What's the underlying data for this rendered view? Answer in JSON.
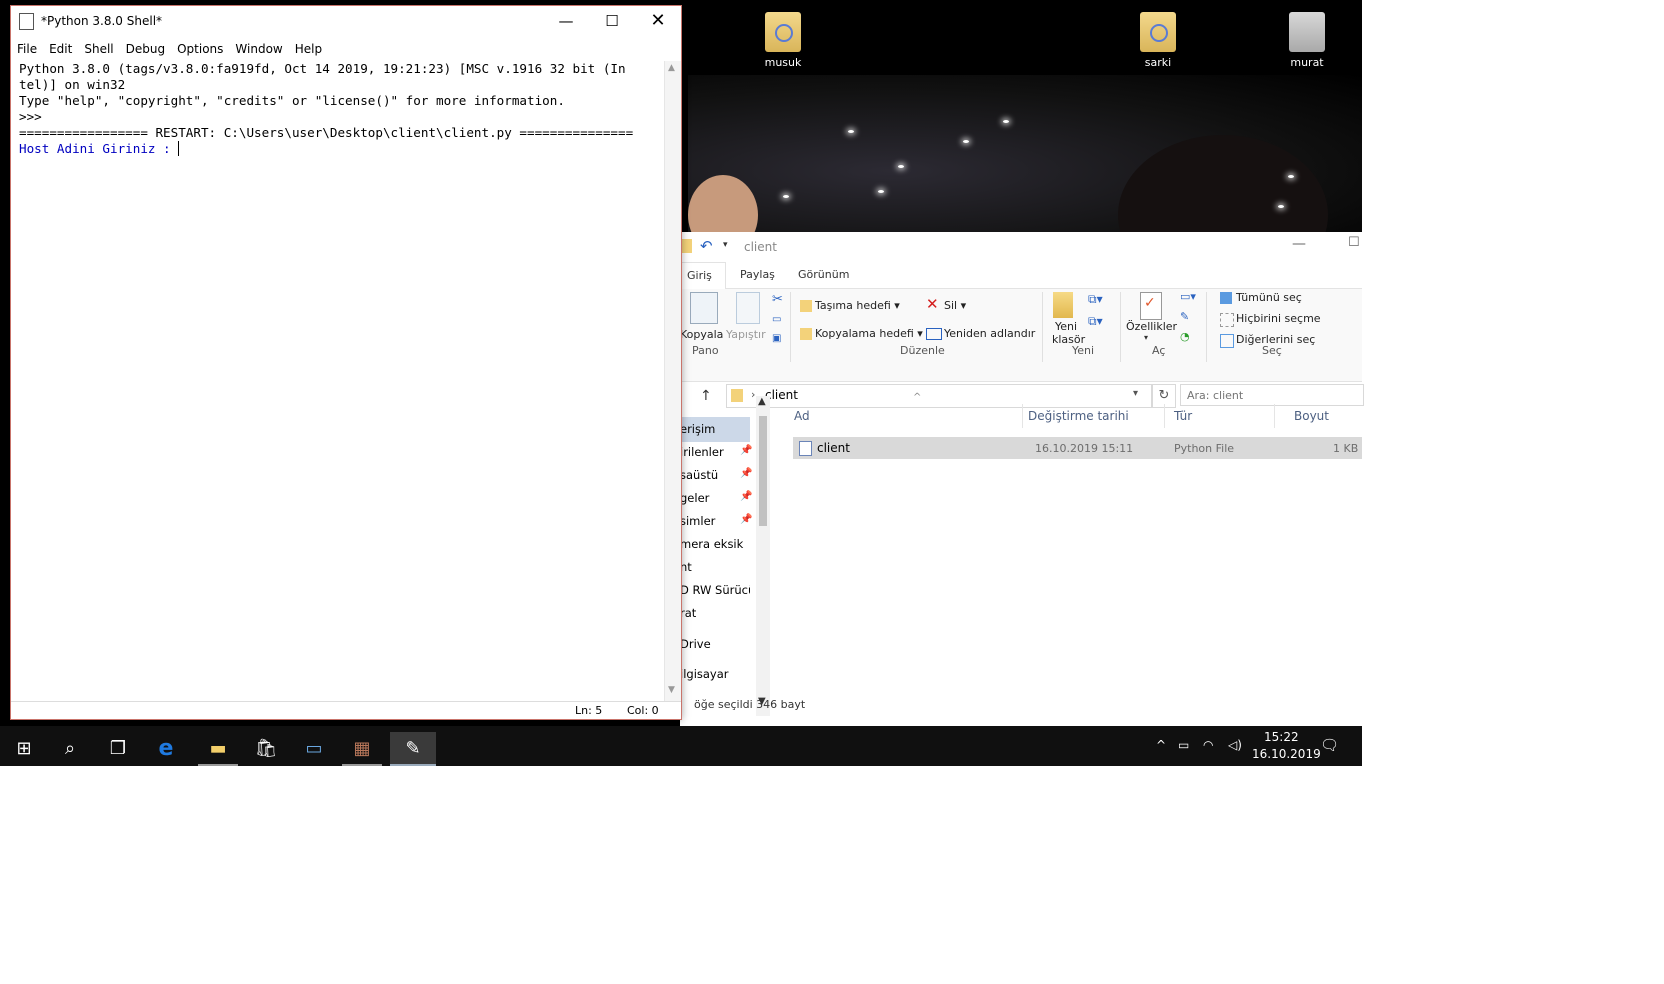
{
  "desktop": {
    "icons": [
      {
        "label": "musuk"
      },
      {
        "label": "sarki"
      },
      {
        "label": "murat"
      }
    ]
  },
  "shell": {
    "title": "*Python 3.8.0 Shell*",
    "menu": [
      "File",
      "Edit",
      "Shell",
      "Debug",
      "Options",
      "Window",
      "Help"
    ],
    "lines": [
      "Python 3.8.0 (tags/v3.8.0:fa919fd, Oct 14 2019, 19:21:23) [MSC v.1916 32 bit (In",
      "tel)] on win32",
      "Type \"help\", \"copyright\", \"credits\" or \"license()\" for more information.",
      ">>> ",
      "================= RESTART: C:\\Users\\user\\Desktop\\client\\client.py ==============="
    ],
    "prompt_line": "Host Adini Giriniz : ",
    "status_ln": "Ln: 5",
    "status_col": "Col: 0"
  },
  "explorer": {
    "title": "client",
    "tabs": [
      "Giriş",
      "Paylaş",
      "Görünüm"
    ],
    "ribbon": {
      "copy": "Kopyala",
      "paste": "Yapıştır",
      "move_to": "Taşıma hedefi",
      "copy_to": "Kopyalama hedefi",
      "delete": "Sil",
      "rename": "Yeniden adlandır",
      "new_folder_1": "Yeni",
      "new_folder_2": "klasör",
      "properties": "Özellikler",
      "select_all": "Tümünü seç",
      "select_none": "Hiçbirini seçme",
      "invert": "Diğerlerini seç",
      "group_clipboard": "Pano",
      "group_organize": "Düzenle",
      "group_new": "Yeni",
      "group_open": "Aç",
      "group_select": "Seç"
    },
    "address": "client",
    "search_placeholder": "Ara: client",
    "nav": [
      "erişim",
      "irilenler",
      "saüstü",
      "geler",
      "simler",
      "mera eksik",
      "nt",
      "D RW Sürücüs",
      "rat",
      "Drive",
      "ilgisayar"
    ],
    "columns": [
      "Ad",
      "Değiştirme tarihi",
      "Tür",
      "Boyut"
    ],
    "files": [
      {
        "name": "client",
        "date": "16.10.2019 15:11",
        "type": "Python File",
        "size": "1 KB"
      }
    ],
    "status": "öğe seçildi  346 bayt"
  },
  "taskbar": {
    "time": "15:22",
    "date": "16.10.2019"
  }
}
